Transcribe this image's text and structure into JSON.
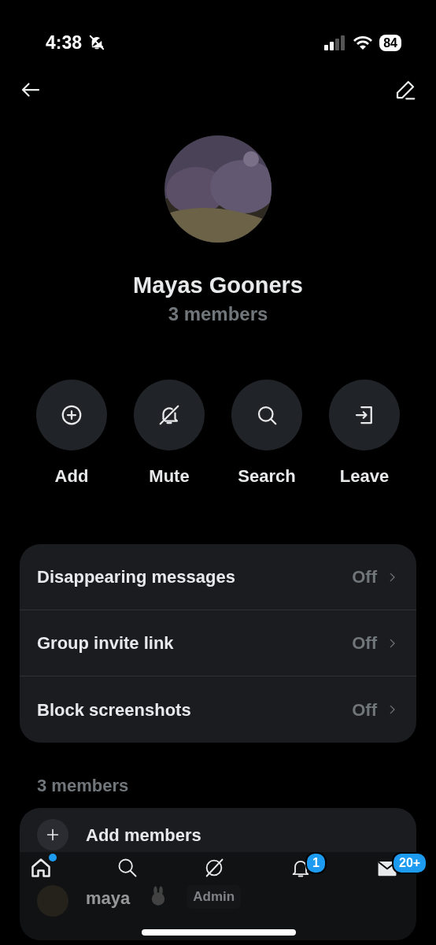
{
  "status_bar": {
    "time": "4:38",
    "battery": "84"
  },
  "group": {
    "name": "Mayas Gooners",
    "subtitle": "3 members"
  },
  "actions": [
    {
      "kind": "add",
      "label": "Add"
    },
    {
      "kind": "mute",
      "label": "Mute"
    },
    {
      "kind": "search",
      "label": "Search"
    },
    {
      "kind": "leave",
      "label": "Leave"
    }
  ],
  "settings": [
    {
      "label": "Disappearing messages",
      "value": "Off"
    },
    {
      "label": "Group invite link",
      "value": "Off"
    },
    {
      "label": "Block screenshots",
      "value": "Off"
    }
  ],
  "members_heading": "3 members",
  "add_members": "Add members",
  "members": [
    {
      "name": "maya",
      "role": "Admin"
    }
  ],
  "nav": [
    {
      "kind": "home",
      "selected": true,
      "dot": true
    },
    {
      "kind": "search",
      "selected": false,
      "dot": false
    },
    {
      "kind": "grok",
      "selected": false,
      "dot": false
    },
    {
      "kind": "bell",
      "selected": false,
      "dot": false,
      "badge": "1"
    },
    {
      "kind": "mail",
      "selected": false,
      "dot": false,
      "badge": "20+"
    }
  ]
}
